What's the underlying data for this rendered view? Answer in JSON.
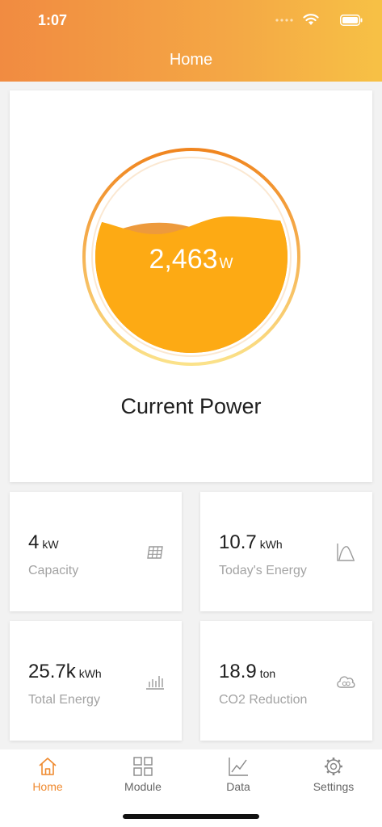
{
  "status": {
    "time": "1:07"
  },
  "header": {
    "title": "Home"
  },
  "power": {
    "value": "2,463",
    "unit": "W",
    "label": "Current Power"
  },
  "stats": [
    {
      "value": "4",
      "unit": "kW",
      "label": "Capacity",
      "icon": "solar-panel-icon"
    },
    {
      "value": "10.7",
      "unit": "kWh",
      "label": "Today's Energy",
      "icon": "curve-icon"
    },
    {
      "value": "25.7k",
      "unit": "kWh",
      "label": "Total Energy",
      "icon": "bar-chart-icon"
    },
    {
      "value": "18.9",
      "unit": "ton",
      "label": "CO2 Reduction",
      "icon": "co2-cloud-icon"
    }
  ],
  "tabs": [
    {
      "label": "Home",
      "icon": "home-icon",
      "active": true
    },
    {
      "label": "Module",
      "icon": "grid-icon",
      "active": false
    },
    {
      "label": "Data",
      "icon": "line-chart-icon",
      "active": false
    },
    {
      "label": "Settings",
      "icon": "gear-icon",
      "active": false
    }
  ],
  "colors": {
    "accent": "#ef8a2f",
    "gauge_fill": "#fdaa14",
    "wave_back": "#ed9a3c"
  }
}
